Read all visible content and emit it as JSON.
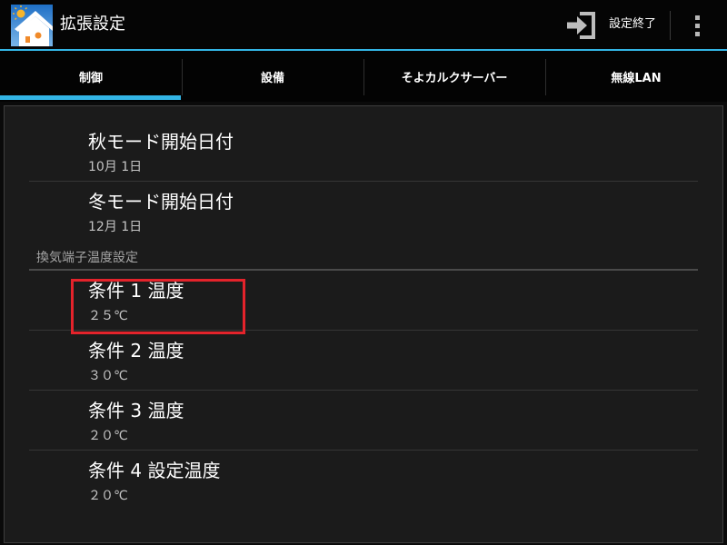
{
  "colors": {
    "accent": "#33b5e5",
    "highlight": "#e4232b"
  },
  "action_bar": {
    "title": "拡張設定",
    "app_icon": "house-sun-icon",
    "end_settings": {
      "label": "設定終了",
      "icon": "exit-icon"
    },
    "overflow_icon": "overflow-menu-icon"
  },
  "tabs": [
    {
      "label": "制御",
      "selected": true
    },
    {
      "label": "設備",
      "selected": false
    },
    {
      "label": "そよカルクサーバー",
      "selected": false
    },
    {
      "label": "無線LAN",
      "selected": false
    }
  ],
  "preferences": {
    "items": [
      {
        "title": "秋モード開始日付",
        "summary": "10月 1日"
      },
      {
        "title": "冬モード開始日付",
        "summary": "12月 1日"
      }
    ],
    "category": {
      "title": "換気端子温度設定",
      "items": [
        {
          "title": "条件 1 温度",
          "summary": "２５℃",
          "highlighted": true
        },
        {
          "title": "条件 2 温度",
          "summary": "３０℃",
          "highlighted": false
        },
        {
          "title": "条件 3 温度",
          "summary": "２０℃",
          "highlighted": false
        },
        {
          "title": "条件 4 設定温度",
          "summary": "２０℃",
          "highlighted": false
        }
      ]
    }
  }
}
